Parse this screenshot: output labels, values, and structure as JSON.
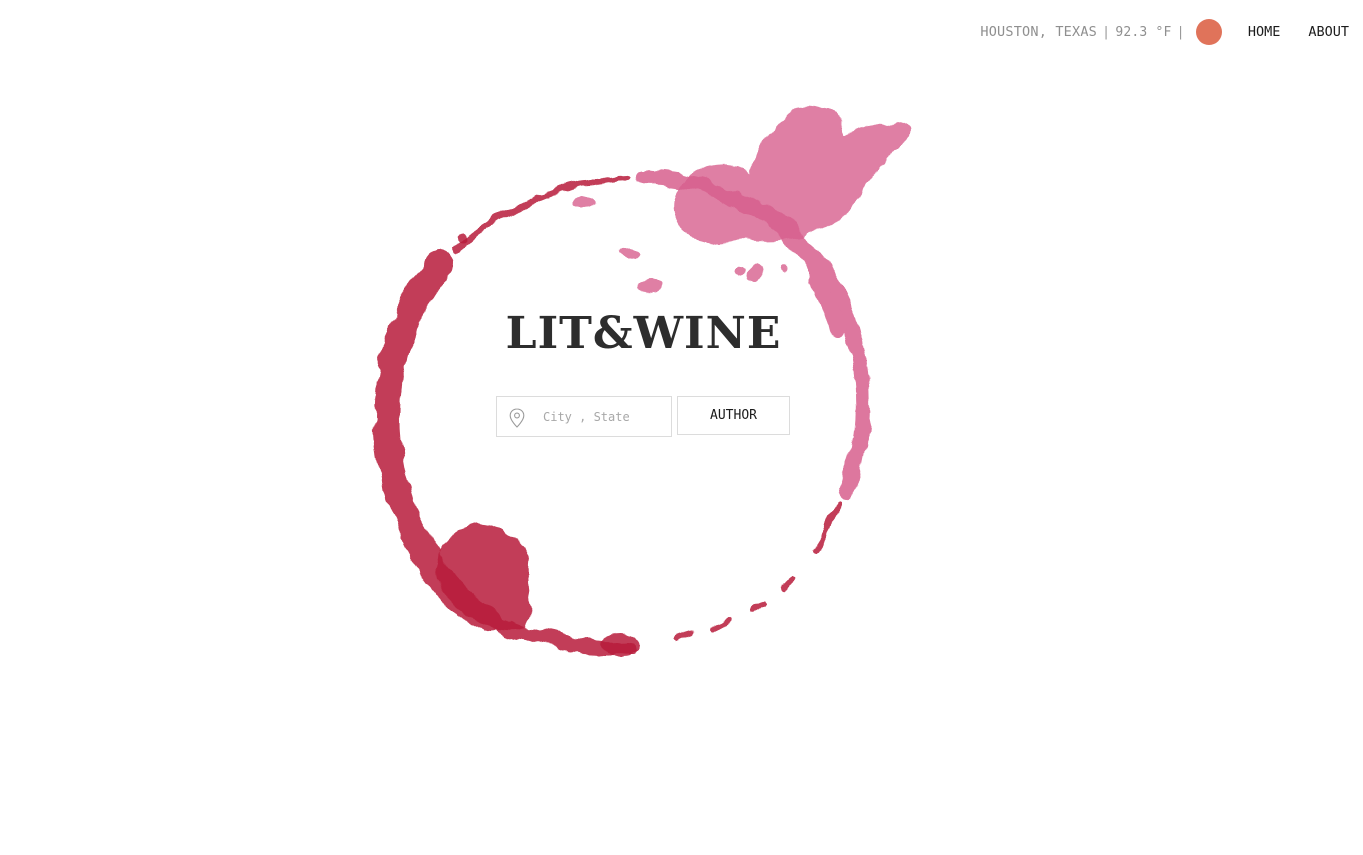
{
  "header": {
    "weather": {
      "location": "HOUSTON, TEXAS",
      "temperature": "92.3 °F",
      "separator": "|",
      "indicator_color": "#e0735a"
    },
    "nav": [
      {
        "label": "HOME"
      },
      {
        "label": "ABOUT"
      }
    ]
  },
  "hero": {
    "title": "LIT&WINE",
    "stain_colors": {
      "light": "#d8608e",
      "dark": "#b81d3a"
    }
  },
  "search": {
    "location_placeholder": "City , State",
    "location_value": "",
    "location_icon": "map-pin-icon",
    "author_label": "AUTHOR"
  }
}
